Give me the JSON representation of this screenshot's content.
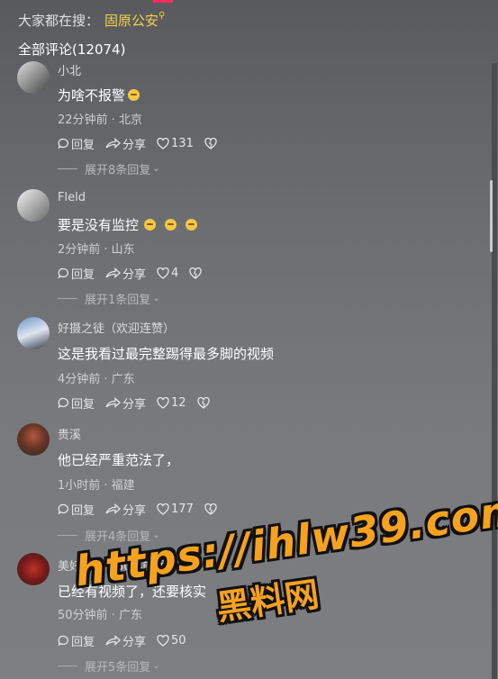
{
  "search": {
    "prefix": "大家都在搜：",
    "keyword": "固原公安",
    "keyword_icon": "search-icon"
  },
  "comments_header": {
    "label": "全部评论(12074)"
  },
  "colors": {
    "accent": "#fe2c55",
    "keyword": "#f7d148",
    "watermark": "#f7a21e"
  },
  "comments": [
    {
      "user": "小北",
      "text": "为啥不报警",
      "emojis": 1,
      "meta": "22分钟前 · 北京",
      "reply": "回复",
      "share": "分享",
      "likes": "131",
      "expand": "展开8条回复"
    },
    {
      "user": "Fleld",
      "text": "要是没有监控",
      "emojis": 3,
      "meta": "2分钟前 · 山东",
      "reply": "回复",
      "share": "分享",
      "likes": "4",
      "expand": "展开1条回复"
    },
    {
      "user": "好摄之徒（欢迎连赞）",
      "text": "这是我看过最完整踢得最多脚的视频",
      "emojis": 0,
      "meta": "4分钟前 · 广东",
      "reply": "回复",
      "share": "分享",
      "likes": "12",
      "expand": ""
    },
    {
      "user": "贵溪",
      "text": "他已经严重范法了，",
      "emojis": 0,
      "meta": "1小时前 · 福建",
      "reply": "回复",
      "share": "分享",
      "likes": "177",
      "expand": "展开4条回复"
    },
    {
      "user": "美好回忆（80年的猴)",
      "text": "已经有视频了，还要核实",
      "emojis": 0,
      "meta": "50分钟前 · 广东",
      "reply": "回复",
      "share": "分享",
      "likes": "50",
      "expand": "展开5条回复"
    }
  ],
  "watermark": {
    "url": "https://ihlw39.com",
    "name": "黑料网"
  }
}
